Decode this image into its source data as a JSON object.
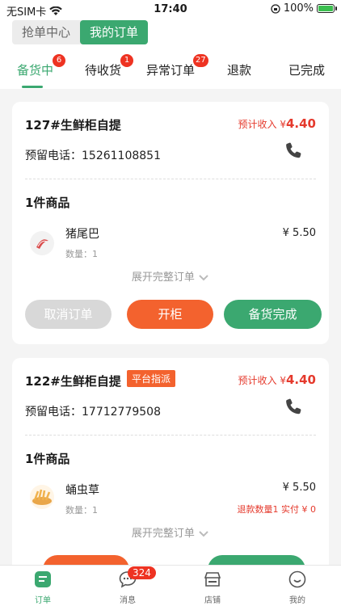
{
  "status": {
    "carrier": "无SIM卡",
    "time": "17:40",
    "battery": "100%"
  },
  "segment": [
    "抢单中心",
    "我的订单"
  ],
  "tabs": [
    {
      "label": "备货中",
      "badge": "6"
    },
    {
      "label": "待收货",
      "badge": "1"
    },
    {
      "label": "异常订单",
      "badge": "27"
    },
    {
      "label": "退款",
      "badge": ""
    },
    {
      "label": "已完成",
      "badge": ""
    }
  ],
  "orders": [
    {
      "title": "127#生鲜柜自提",
      "tag": "",
      "income_label": "预计收入 ¥",
      "income": "4.40",
      "phone": "预留电话：15261108851",
      "count": "1件商品",
      "item": {
        "name": "猪尾巴",
        "qty": "数量：1",
        "price": "¥ 5.50",
        "refund": ""
      },
      "expand": "展开完整订单",
      "buttons": [
        "取消订单",
        "开柜",
        "备货完成"
      ]
    },
    {
      "title": "122#生鲜柜自提",
      "tag": "平台指派",
      "income_label": "预计收入 ¥",
      "income": "4.40",
      "phone": "预留电话：17712779508",
      "count": "1件商品",
      "item": {
        "name": "蛹虫草",
        "qty": "数量：1",
        "price": "¥ 5.50",
        "refund": "退款数量1 实付 ¥ 0"
      },
      "expand": "展开完整订单",
      "buttons": [
        "",
        ""
      ]
    }
  ],
  "nav": [
    {
      "label": "订单",
      "badge": ""
    },
    {
      "label": "消息",
      "badge": "324"
    },
    {
      "label": "店铺",
      "badge": ""
    },
    {
      "label": "我的",
      "badge": ""
    }
  ],
  "colors": {
    "accent": "#3ba870",
    "orange": "#f3622e",
    "red": "#e53a2d"
  }
}
